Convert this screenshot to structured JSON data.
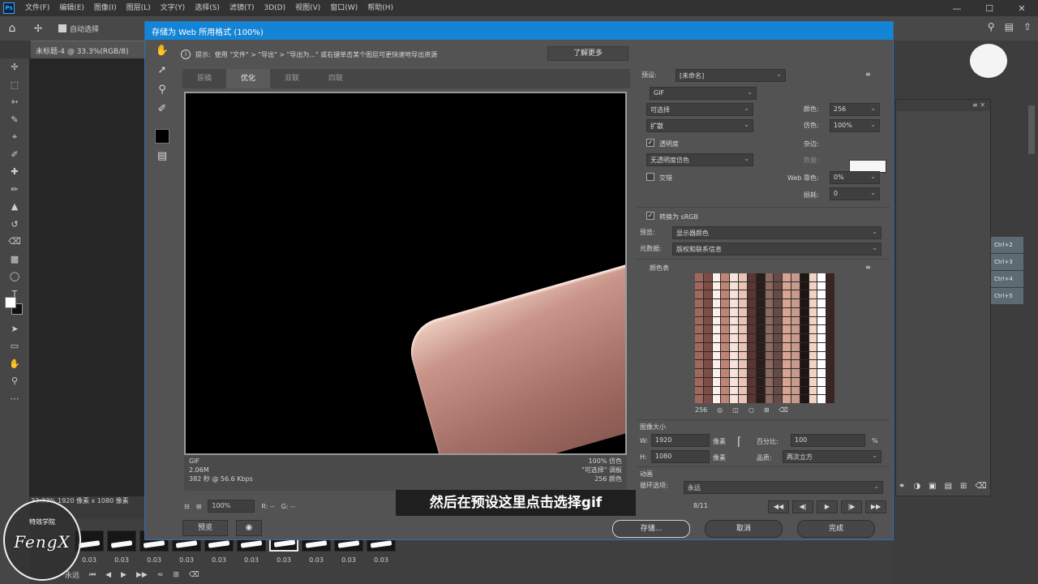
{
  "app": {
    "menu": [
      "文件(F)",
      "编辑(E)",
      "图像(I)",
      "图层(L)",
      "文字(Y)",
      "选择(S)",
      "滤镜(T)",
      "3D(D)",
      "视图(V)",
      "窗口(W)",
      "帮助(H)"
    ],
    "auto_select": "自动选择",
    "doc_tab": "未标题-4 @ 33.3%(RGB/8)",
    "doc_status": "33.33%    1920 像素 x 1080 像素",
    "shortcuts": [
      "Ctrl+2",
      "Ctrl+3",
      "Ctrl+4",
      "Ctrl+5"
    ]
  },
  "dialog": {
    "title": "存储为 Web 所用格式 (100%)",
    "hint_label": "提示:",
    "hint_text": "使用 \"文件\" > \"导出\" > \"导出为...\" 或右键单击某个图层可更快速地导出资源",
    "learn_more": "了解更多",
    "tabs": [
      "原稿",
      "优化",
      "双联",
      "四联"
    ],
    "active_tab": "优化",
    "info_left": [
      "GIF",
      "2.06M",
      "382 秒 @ 56.6 Kbps"
    ],
    "info_right": [
      "100% 仿色",
      "\"可选择\" 调板",
      "256 颜色"
    ],
    "zoom": "100%",
    "r_label": "R: --",
    "g_label": "G: --",
    "preview_btn": "预览",
    "save_btn": "存储...",
    "cancel_btn": "取消",
    "done_btn": "完成",
    "subtitle": "然后在预设这里点击选择gif"
  },
  "settings": {
    "preset_label": "预设:",
    "preset_value": "[未命名]",
    "format": "GIF",
    "reduction": "可选择",
    "dither_algo": "扩散",
    "transparency_label": "透明度",
    "transparency_dither": "无透明度仿色",
    "interlaced_label": "交错",
    "colors_label": "颜色:",
    "colors_value": "256",
    "dither_label": "仿色:",
    "dither_value": "100%",
    "matte_label": "杂边:",
    "amount_label": "数量:",
    "websnap_label": "Web 靠色:",
    "websnap_value": "0%",
    "lossy_label": "损耗:",
    "lossy_value": "0",
    "convert_srgb": "转换为 sRGB",
    "preview_label": "预览:",
    "preview_value": "显示器颜色",
    "metadata_label": "元数据:",
    "metadata_value": "版权和联系信息",
    "color_table_title": "颜色表",
    "color_count": "256",
    "image_size_title": "图像大小",
    "w_label": "W:",
    "w_value": "1920",
    "h_label": "H:",
    "h_value": "1080",
    "unit": "像素",
    "percent_label": "百分比:",
    "percent_value": "100",
    "percent_unit": "%",
    "quality_label": "品质:",
    "quality_value": "两次立方",
    "animation_title": "动画",
    "loop_label": "循环选项:",
    "loop_value": "永远",
    "frame_counter": "8/11"
  },
  "timeline": {
    "frame_times": [
      "0.03",
      "0.03",
      "0.03",
      "0.03",
      "0.03",
      "0.03",
      "0.03",
      "0.03",
      "0.03",
      "0.03"
    ],
    "loop": "永远"
  },
  "watermark": {
    "top": "特效学院",
    "brand": "FengX"
  },
  "colors": {
    "dialog_title_bar": "#1484d7",
    "dialog_bg": "#535353",
    "panel_bg": "#3f3f3f"
  }
}
